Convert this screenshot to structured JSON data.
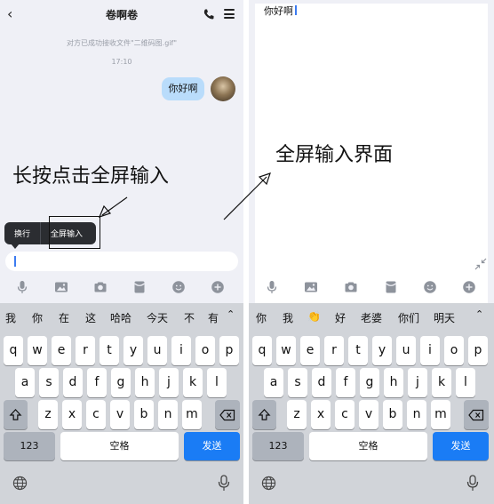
{
  "left_screen": {
    "header": {
      "title": "卷啊卷"
    },
    "system_message": "对方已成功接收文件\"二维码图.gif\"",
    "timestamp": "17:10",
    "message": "你好啊",
    "annotation": "长按点击全屏输入",
    "context_menu": {
      "item1": "换行",
      "item2": "全屏输入"
    },
    "candidates": [
      "我",
      "你",
      "在",
      "这",
      "哈哈",
      "今天",
      "不",
      "有"
    ],
    "keyboard": {
      "row1": [
        "q",
        "w",
        "e",
        "r",
        "t",
        "y",
        "u",
        "i",
        "o",
        "p"
      ],
      "row2": [
        "a",
        "s",
        "d",
        "f",
        "g",
        "h",
        "j",
        "k",
        "l"
      ],
      "row3": [
        "z",
        "x",
        "c",
        "v",
        "b",
        "n",
        "m"
      ],
      "num_key": "123",
      "space_key": "空格",
      "send_key": "发送"
    }
  },
  "right_screen": {
    "fullscreen_text": "你好啊",
    "annotation": "全屏输入界面",
    "candidates": [
      "你",
      "我",
      "👏",
      "好",
      "老婆",
      "你们",
      "明天"
    ],
    "keyboard": {
      "row1": [
        "q",
        "w",
        "e",
        "r",
        "t",
        "y",
        "u",
        "i",
        "o",
        "p"
      ],
      "row2": [
        "a",
        "s",
        "d",
        "f",
        "g",
        "h",
        "j",
        "k",
        "l"
      ],
      "row3": [
        "z",
        "x",
        "c",
        "v",
        "b",
        "n",
        "m"
      ],
      "num_key": "123",
      "space_key": "空格",
      "send_key": "发送"
    }
  },
  "icons": {
    "back": "chevron-left-icon",
    "call": "phone-icon",
    "menu": "menu-icon",
    "toolbar": [
      "microphone-icon",
      "image-icon",
      "camera-icon",
      "red-packet-icon",
      "emoji-icon",
      "plus-icon"
    ],
    "collapse": "shrink-icon",
    "globe": "globe-icon",
    "dictation": "microphone-icon"
  },
  "colors": {
    "accent": "#1a7cf5",
    "bubble": "#b9dcfb",
    "context_menu": "#2b2d31"
  }
}
